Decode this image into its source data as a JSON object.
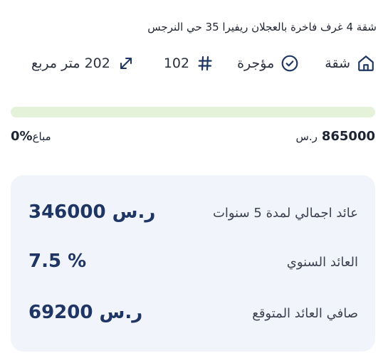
{
  "listing": {
    "title": "شقة 4 غرف فاخرة بالعجلان ريفيرا 35 حي النرجس",
    "type_label": "شقة",
    "status_label": "مؤجرة",
    "unit_number": "102",
    "area": "202 متر مربع",
    "icons": {
      "type": "home-icon",
      "status": "check-circle-icon",
      "number": "hash-icon",
      "area": "expand-arrows-icon"
    }
  },
  "funding": {
    "progress_fraction": 0.0,
    "price_value": "865000",
    "price_currency": "ر.س",
    "sold_value": "0%",
    "sold_label": "مباع"
  },
  "stats": [
    {
      "label": "عائد اجمالي لمدة 5 سنوات",
      "value": "346000 ر.س"
    },
    {
      "label": "العائد السنوي",
      "value": "7.5 %"
    },
    {
      "label": "صافي العائد المتوقع",
      "value": "69200 ر.س"
    }
  ],
  "colors": {
    "accent": "#1f3563",
    "progress_track": "#e3f2d8",
    "stats_bg": "#f1f4fa"
  }
}
